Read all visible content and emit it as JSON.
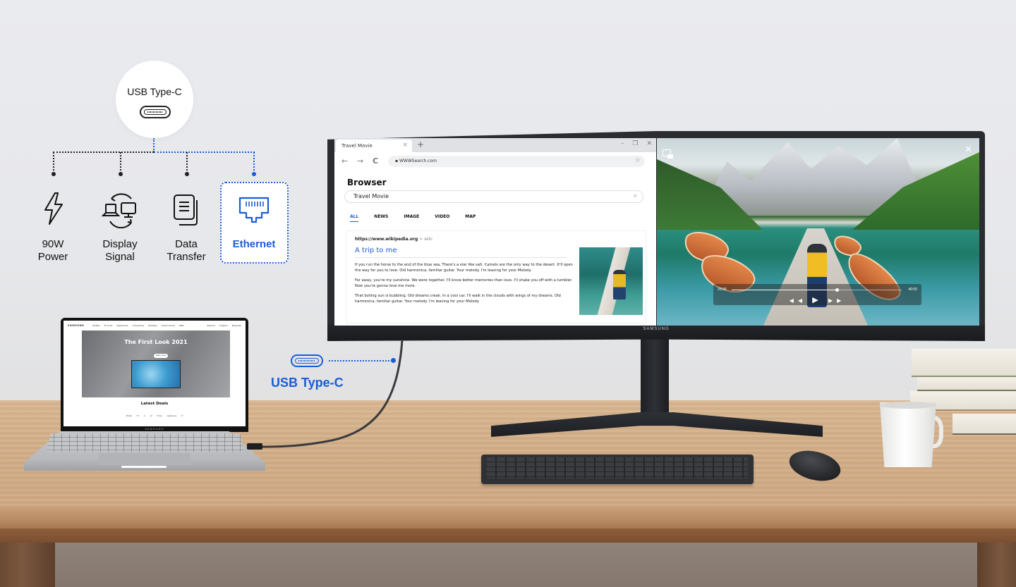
{
  "diagram": {
    "hub": {
      "title": "USB Type-C",
      "icon": "usb-type-c-port-icon"
    },
    "features": [
      {
        "icon": "lightning-bolt-icon",
        "label_line1": "90W",
        "label_line2": "Power",
        "highlighted": false
      },
      {
        "icon": "laptop-monitor-sync-icon",
        "label_line1": "Display",
        "label_line2": "Signal",
        "highlighted": false
      },
      {
        "icon": "documents-icon",
        "label_line1": "Data",
        "label_line2": "Transfer",
        "highlighted": false
      },
      {
        "icon": "ethernet-port-icon",
        "label_line1": "Ethernet",
        "label_line2": "",
        "highlighted": true
      }
    ],
    "highlight_color": "#1b5cd6"
  },
  "connection": {
    "label": "USB Type-C",
    "icon": "usb-type-c-port-icon",
    "color": "#1b5cd6"
  },
  "monitor": {
    "brand": "SAMSUNG",
    "browser": {
      "tab_title": "Travel Movie",
      "tab_close": "×",
      "new_tab": "+",
      "window_controls": [
        "–",
        "❐",
        "✕"
      ],
      "nav": {
        "back": "←",
        "forward": "→",
        "reload": "C"
      },
      "url": "WWWSearch.com",
      "bookmark_icon": "☆",
      "page_title": "Browser",
      "search_value": "Travel Movie",
      "search_icon": "⌕",
      "result_tabs": [
        "ALL",
        "NEWS",
        "IMAGE",
        "VIDEO",
        "MAP"
      ],
      "active_result_tab": "ALL",
      "result": {
        "url_main": "https://www.wikipedia.org",
        "url_path": " > wiki",
        "title": "A trip to me",
        "paragraphs": [
          "If you run the horse to the end of the blue sea, There's a star like salt. Camels are the only way to the desert. It'll open the way for you to love. Old harmonica, familiar guitar. Your melody. I'm leaving for your Melody.",
          "Far away, you're my sunshine. We were together. I'll know better memories than love. I'll shake you off with a tumbler. Now you're gonna love me more.",
          "That boiling sun is bubbling. Old dreams creak. In a cool car. I'll walk in the clouds with wings of my dreams. Old harmonica, familiar guitar. Your melody. I'm leaving for your Melody."
        ]
      }
    },
    "video": {
      "current_time": "25:00",
      "total_time": "40:00",
      "progress_fraction": 0.62,
      "controls": {
        "rewind": "◀◀",
        "play": "▶",
        "forward": "▶▶"
      },
      "close": "✕"
    }
  },
  "laptop": {
    "brand": "SAMSUNG",
    "site": {
      "brand": "SAMSUNG",
      "nav_items": [
        "Mobile",
        "TV & AV",
        "Appliances",
        "Computing",
        "Displays",
        "Smart Home",
        "Offer"
      ],
      "nav_right": [
        "Explore",
        "Support",
        "Business"
      ],
      "hero_title": "The First Look 2021",
      "hero_button": "Learn more",
      "section_title": "Latest Deals",
      "section_tabs": [
        "Mobile",
        "TV & AV",
        "Home Appliances",
        "IT"
      ]
    }
  }
}
